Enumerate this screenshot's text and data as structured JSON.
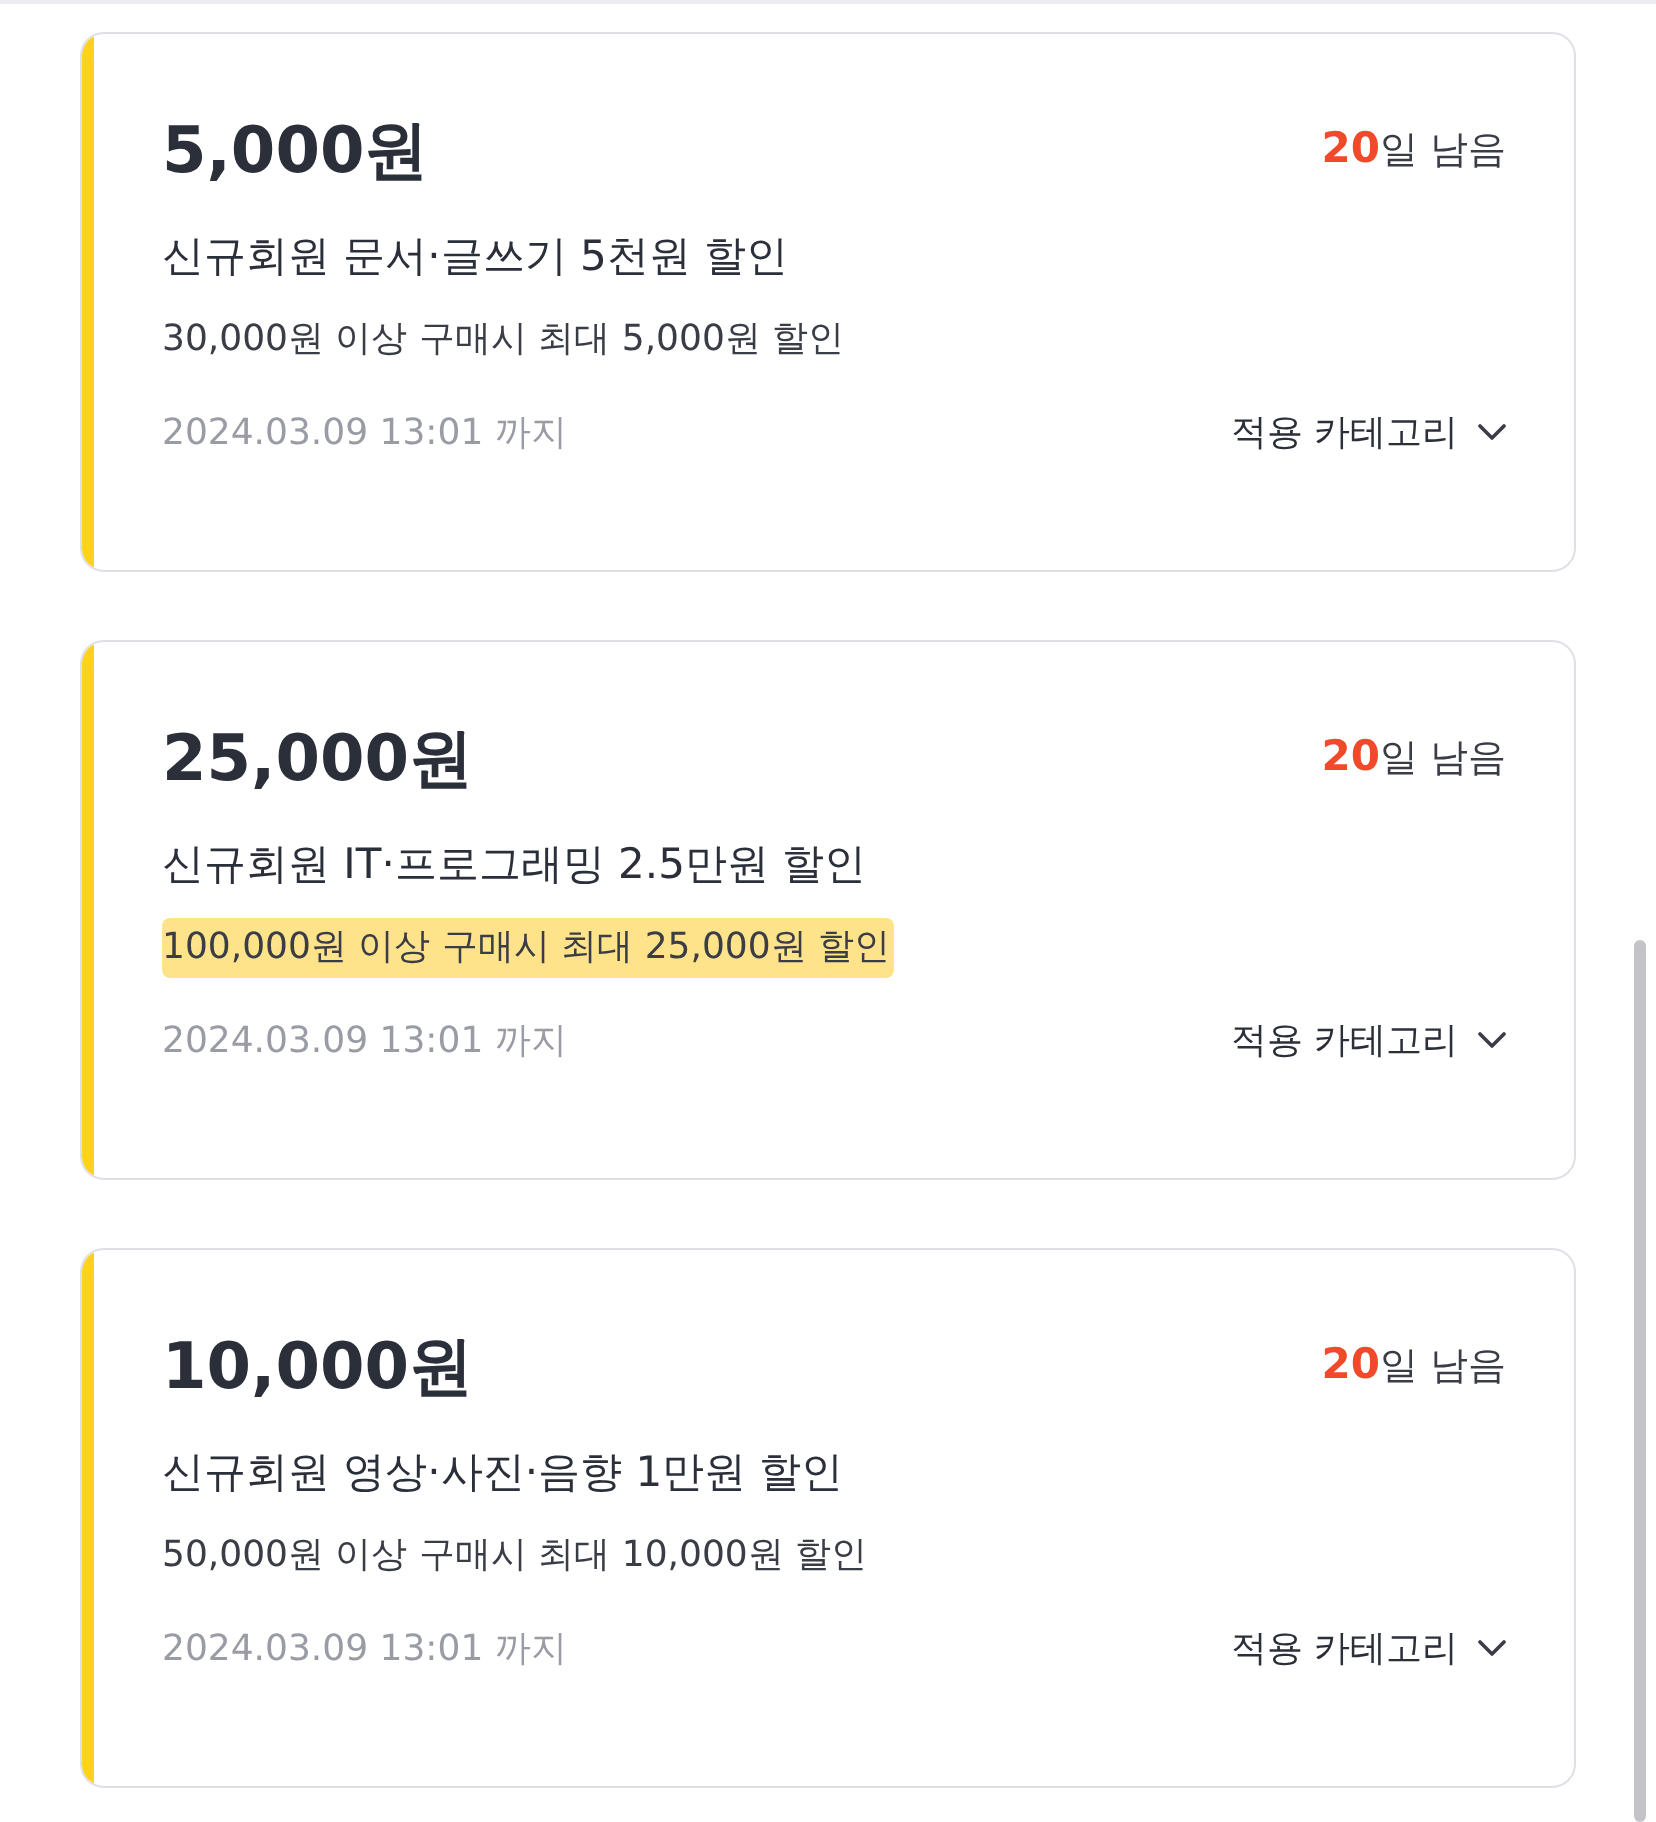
{
  "coupons": [
    {
      "amount": "5,000원",
      "days_left": "20",
      "days_suffix": "일 남음",
      "title": "신규회원 문서·글쓰기 5천원 할인",
      "condition": "30,000원 이상 구매시 최대 5,000원 할인",
      "highlighted": false,
      "expiry": "2024.03.09 13:01 까지",
      "category_label": "적용 카테고리"
    },
    {
      "amount": "25,000원",
      "days_left": "20",
      "days_suffix": "일 남음",
      "title": "신규회원 IT·프로그래밍 2.5만원 할인",
      "condition": "100,000원 이상 구매시 최대 25,000원 할인",
      "highlighted": true,
      "expiry": "2024.03.09 13:01 까지",
      "category_label": "적용 카테고리"
    },
    {
      "amount": "10,000원",
      "days_left": "20",
      "days_suffix": "일 남음",
      "title": "신규회원 영상·사진·음향 1만원 할인",
      "condition": "50,000원 이상 구매시 최대 10,000원 할인",
      "highlighted": false,
      "expiry": "2024.03.09 13:01 까지",
      "category_label": "적용 카테고리"
    }
  ]
}
